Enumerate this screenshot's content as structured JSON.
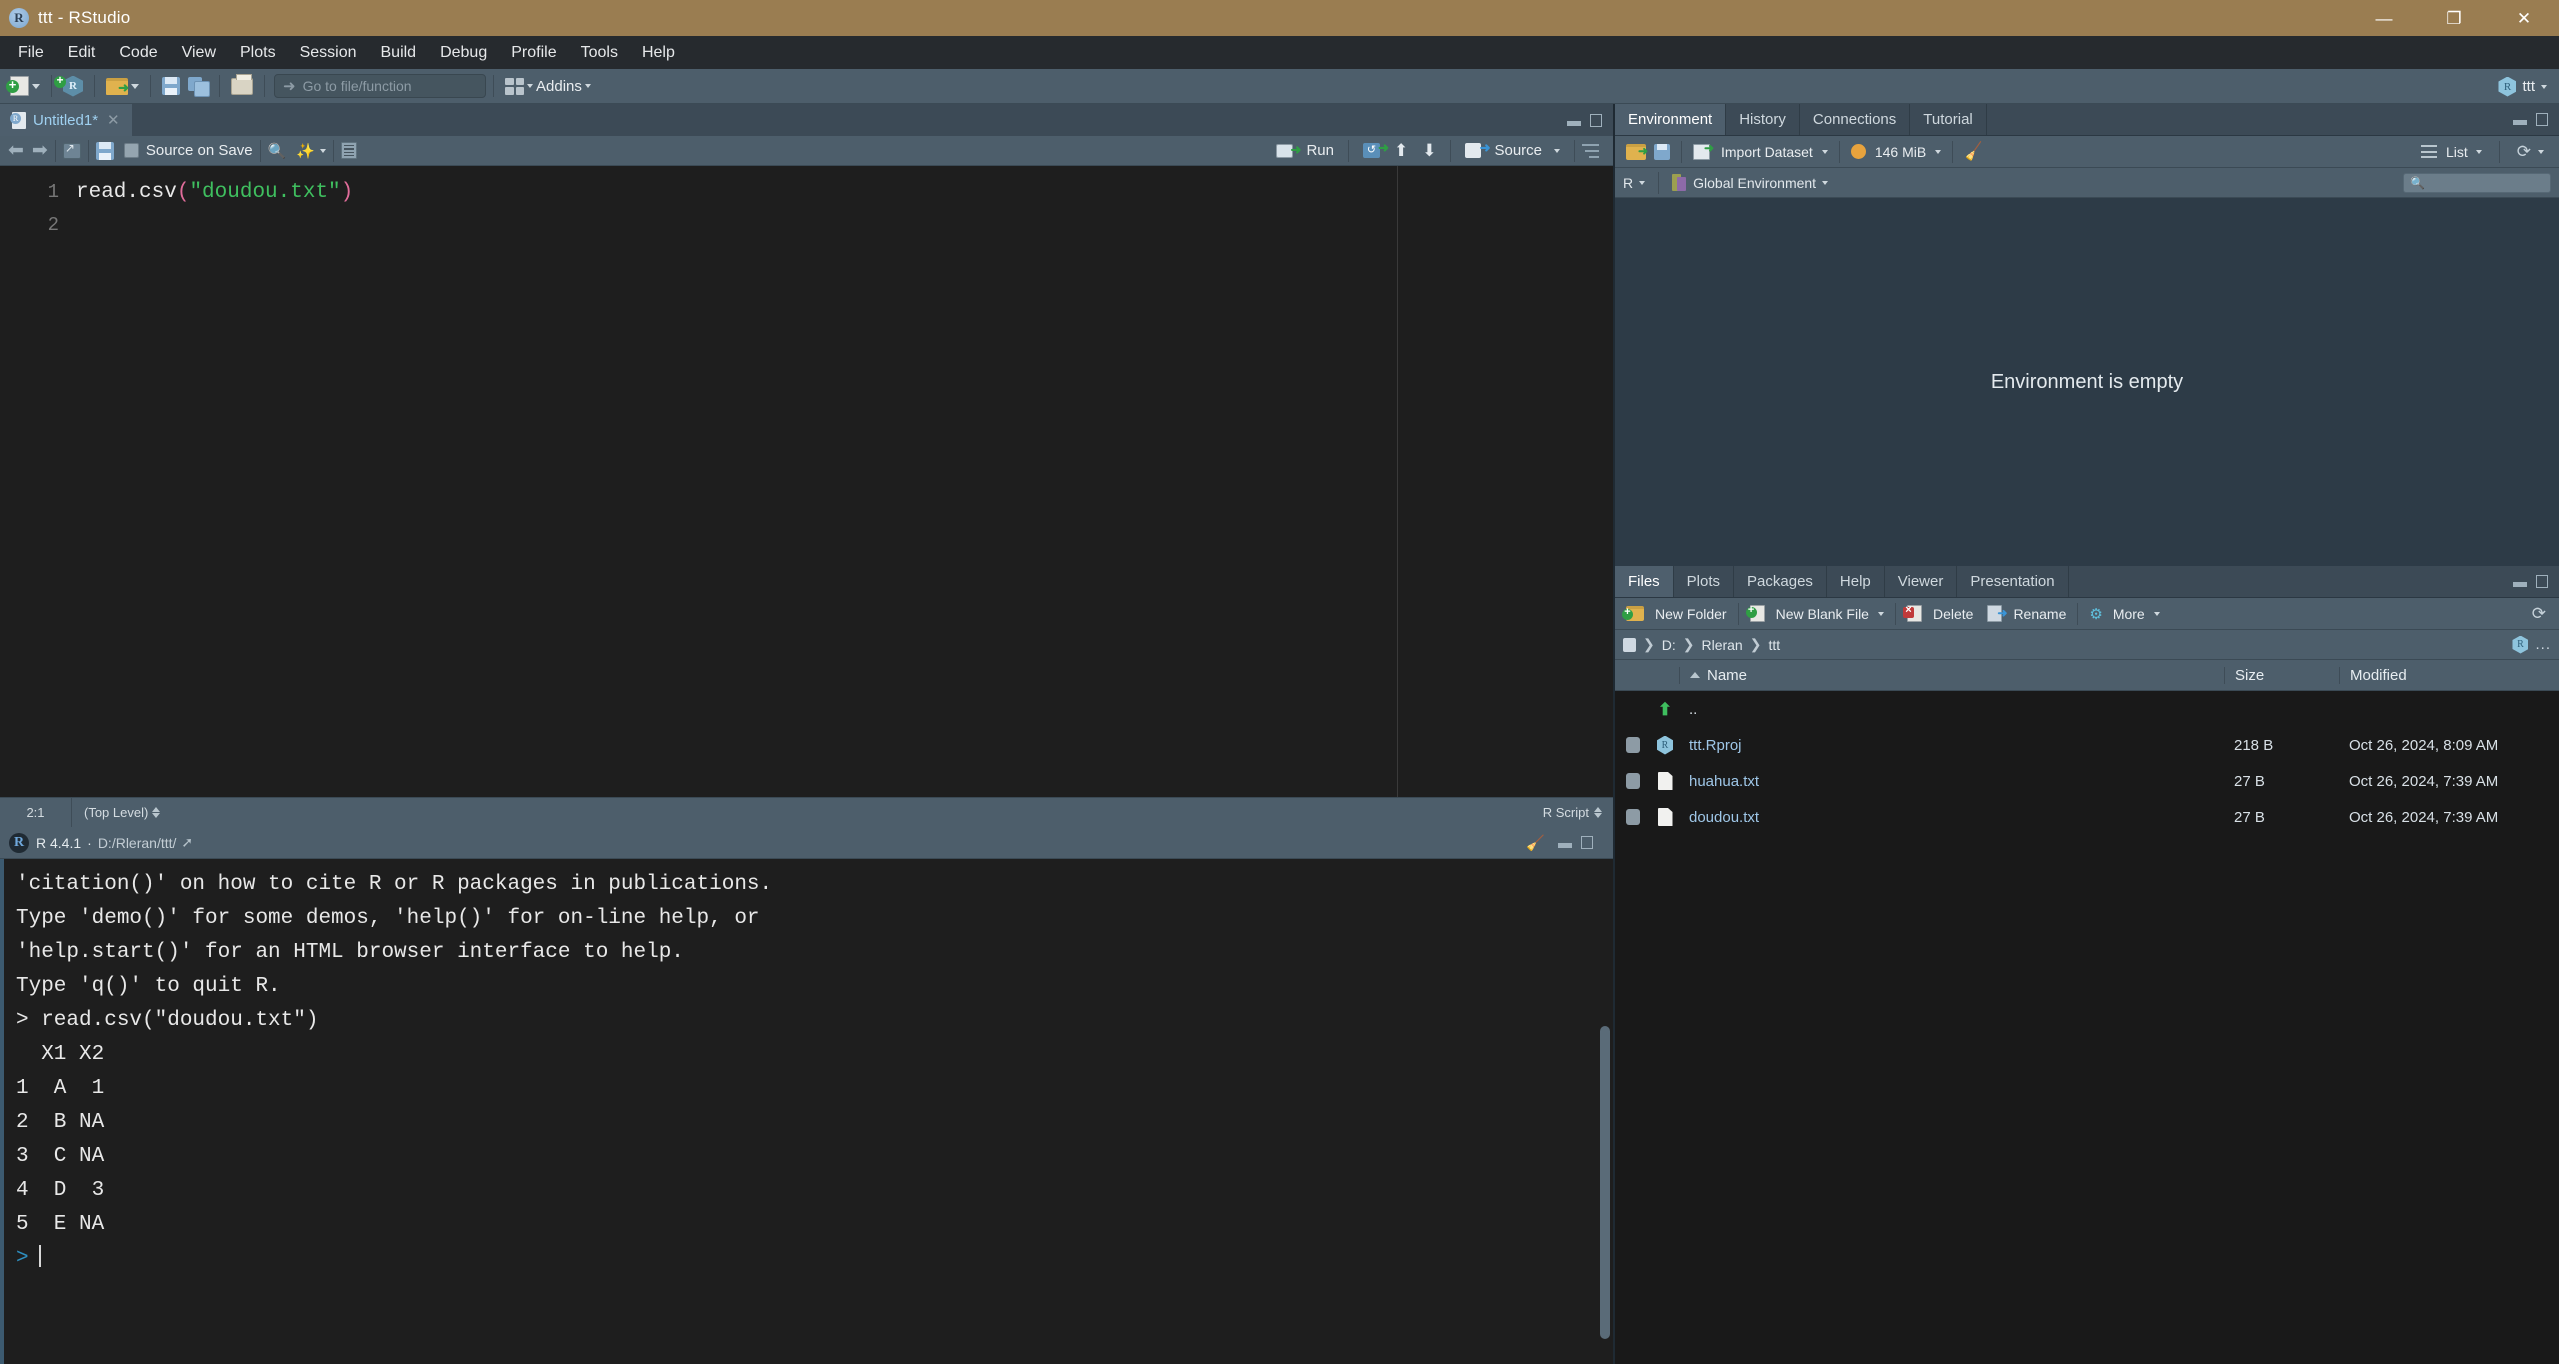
{
  "titlebar": {
    "title": "ttt - RStudio",
    "logo_icon": "r-logo-icon",
    "minimize": "—",
    "maximize": "❐",
    "close": "✕"
  },
  "menubar": {
    "items": [
      "File",
      "Edit",
      "Code",
      "View",
      "Plots",
      "Session",
      "Build",
      "Debug",
      "Profile",
      "Tools",
      "Help"
    ]
  },
  "main_toolbar": {
    "new_file_icon": "new-file-icon",
    "new_project_icon": "new-project-icon",
    "open_file_icon": "open-file-icon",
    "save_icon": "save-icon",
    "save_all_icon": "save-all-icon",
    "print_icon": "print-icon",
    "goto_placeholder": "Go to file/function",
    "addins_label": "Addins",
    "addins_icon": "addins-grid-icon",
    "project_name": "ttt",
    "project_icon": "r-project-icon"
  },
  "source": {
    "tab": {
      "name": "Untitled1*",
      "icon": "r-script-icon",
      "close": "✕"
    },
    "toolbar": {
      "back_icon": "back-arrow-icon",
      "forward_icon": "forward-arrow-icon",
      "show_in_new_window_icon": "popout-window-icon",
      "save_icon": "save-icon",
      "source_on_save_label": "Source on Save",
      "find_icon": "magnifier-icon",
      "code_tools_icon": "magic-wand-icon",
      "compile_report_icon": "compile-report-icon",
      "run_label": "Run",
      "run_icon": "run-icon",
      "rerun_icon": "rerun-icon",
      "prev_chunk_icon": "arrow-up-icon",
      "next_chunk_icon": "arrow-down-icon",
      "source_label": "Source",
      "source_icon": "source-icon",
      "outline_icon": "document-outline-icon"
    },
    "gutter": [
      "1",
      "2"
    ],
    "code_lines": [
      {
        "tokens": [
          {
            "t": "read.csv",
            "cls": "tk-fn"
          },
          {
            "t": "(",
            "cls": "tk-paren"
          },
          {
            "t": "\"doudou.txt\"",
            "cls": "tk-str"
          },
          {
            "t": ")",
            "cls": "tk-paren"
          }
        ]
      },
      {
        "tokens": []
      }
    ],
    "status": {
      "position": "2:1",
      "scope": "(Top Level)",
      "file_type": "R Script"
    }
  },
  "console": {
    "r_icon": "r-console-icon",
    "version": "R 4.4.1",
    "separator": "·",
    "path": "D:/Rleran/ttt/",
    "popout_icon": "popout-icon",
    "clear_icon": "broom-icon",
    "lines": [
      {
        "text": "'citation()' on how to cite R or R packages in publications.",
        "cls": ""
      },
      {
        "text": "",
        "cls": ""
      },
      {
        "text": "Type 'demo()' for some demos, 'help()' for on-line help, or",
        "cls": ""
      },
      {
        "text": "'help.start()' for an HTML browser interface to help.",
        "cls": ""
      },
      {
        "text": "Type 'q()' to quit R.",
        "cls": ""
      },
      {
        "text": "",
        "cls": ""
      },
      {
        "text": "> read.csv(\"doudou.txt\")",
        "cls": "c-cmd"
      },
      {
        "text": "  X1 X2",
        "cls": ""
      },
      {
        "text": "1  A  1",
        "cls": ""
      },
      {
        "text": "2  B NA",
        "cls": ""
      },
      {
        "text": "3  C NA",
        "cls": ""
      },
      {
        "text": "4  D  3",
        "cls": ""
      },
      {
        "text": "5  E NA",
        "cls": ""
      }
    ],
    "prompt": ">"
  },
  "environment": {
    "tabs": [
      "Environment",
      "History",
      "Connections",
      "Tutorial"
    ],
    "active_tab": "Environment",
    "toolbar": {
      "load_icon": "open-workspace-icon",
      "save_icon": "save-workspace-icon",
      "import_label": "Import Dataset",
      "import_icon": "import-dataset-icon",
      "memory_label": "146 MiB",
      "memory_icon": "memory-usage-icon",
      "clear_icon": "broom-icon",
      "view_label": "List",
      "view_icon": "list-view-icon",
      "refresh_icon": "refresh-icon"
    },
    "scope": {
      "language": "R",
      "name": "Global Environment",
      "env_icon": "global-environment-icon",
      "search_icon": "search-icon",
      "search_value": "",
      "search_placeholder": ""
    },
    "empty_message": "Environment is empty"
  },
  "files": {
    "tabs": [
      "Files",
      "Plots",
      "Packages",
      "Help",
      "Viewer",
      "Presentation"
    ],
    "active_tab": "Files",
    "toolbar": {
      "new_folder_label": "New Folder",
      "new_folder_icon": "new-folder-icon",
      "new_blank_file_label": "New Blank File",
      "new_blank_file_icon": "new-blank-file-icon",
      "delete_label": "Delete",
      "delete_icon": "delete-icon",
      "rename_label": "Rename",
      "rename_icon": "rename-icon",
      "more_label": "More",
      "more_icon": "gear-icon",
      "refresh_icon": "refresh-icon"
    },
    "path": {
      "home_icon": "home-folder-icon",
      "crumbs": [
        "D:",
        "Rleran",
        "ttt"
      ],
      "separator": "❯",
      "project_icon": "r-project-icon",
      "overflow": "..."
    },
    "columns": [
      "Name",
      "Size",
      "Modified"
    ],
    "sort_icon": "sort-ascending-icon",
    "rows": [
      {
        "name": "..",
        "size": "",
        "modified": "",
        "icon": "parent-folder-icon",
        "checkbox": false,
        "link": false
      },
      {
        "name": "ttt.Rproj",
        "size": "218 B",
        "modified": "Oct 26, 2024, 8:09 AM",
        "icon": "r-project-icon",
        "checkbox": true,
        "link": true
      },
      {
        "name": "huahua.txt",
        "size": "27 B",
        "modified": "Oct 26, 2024, 7:39 AM",
        "icon": "text-file-icon",
        "checkbox": true,
        "link": true
      },
      {
        "name": "doudou.txt",
        "size": "27 B",
        "modified": "Oct 26, 2024, 7:39 AM",
        "icon": "text-file-icon",
        "checkbox": true,
        "link": true
      }
    ]
  },
  "colors": {
    "titlebar": "#9a7d51",
    "menubar": "#262a2e",
    "toolbar": "#4d5e6b",
    "panel": "#2d3b47",
    "editor_bg": "#1e1e1e",
    "string_green": "#3fbf5f",
    "paren_pink": "#e06c9a",
    "console_blue": "#2e8fc0",
    "link_blue": "#9fc7e8"
  }
}
